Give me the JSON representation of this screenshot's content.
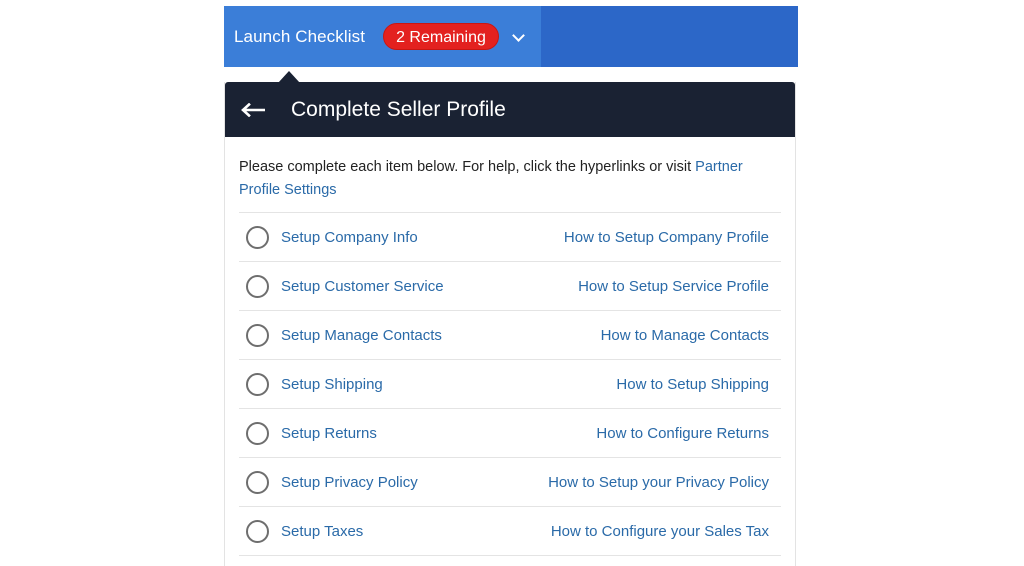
{
  "topbar": {
    "title": "Launch Checklist",
    "badge": "2 Remaining",
    "chevron_icon": "chevron-down-icon"
  },
  "panel": {
    "back_icon": "arrow-left-icon",
    "title": "Complete Seller Profile",
    "intro_text": "Please complete each item below. For help, click the hyperlinks or visit ",
    "intro_link": "Partner Profile Settings"
  },
  "items": [
    {
      "task": "Setup Company Info",
      "help": "How to Setup Company Profile"
    },
    {
      "task": "Setup Customer Service",
      "help": "How to Setup Service Profile"
    },
    {
      "task": "Setup Manage Contacts",
      "help": "How to Manage Contacts"
    },
    {
      "task": "Setup Shipping",
      "help": "How to Setup Shipping"
    },
    {
      "task": "Setup Returns",
      "help": "How to Configure Returns"
    },
    {
      "task": "Setup Privacy Policy",
      "help": "How to Setup your Privacy Policy"
    },
    {
      "task": "Setup Taxes",
      "help": "How to Configure your Sales Tax"
    }
  ],
  "colors": {
    "topbar_blue": "#2f6fd0",
    "badge_red": "#e3211f",
    "header_dark": "#1a2233",
    "link_blue": "#2a6aa8"
  }
}
